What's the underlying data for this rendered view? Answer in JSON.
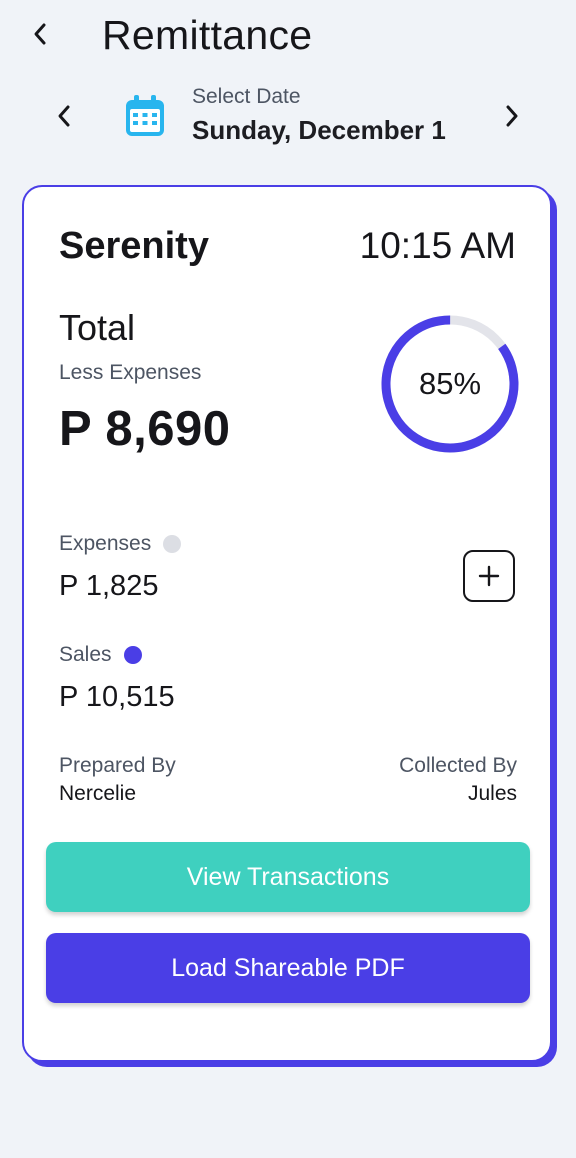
{
  "header": {
    "title": "Remittance",
    "back_icon": "chevron-left-icon"
  },
  "date_selector": {
    "caption": "Select Date",
    "value": "Sunday, December 1",
    "icon": "calendar-icon",
    "icon_color": "#28b5ee"
  },
  "card": {
    "unit_name": "Serenity",
    "time": "10:15 AM",
    "total_label": "Total",
    "total_sublabel": "Less Expenses",
    "total_value": "P 8,690",
    "progress": {
      "percent": 85,
      "label": "85%",
      "fill_color": "#4a3ee6",
      "track_color": "#e3e4ea"
    },
    "expenses": {
      "label": "Expenses",
      "value": "P 1,825",
      "dot_color": "#dcdee4"
    },
    "sales": {
      "label": "Sales",
      "value": "P 10,515",
      "dot_color": "#4a3ee6"
    },
    "add_icon": "plus-icon",
    "prepared_by": {
      "label": "Prepared By",
      "name": "Nercelie"
    },
    "collected_by": {
      "label": "Collected By",
      "name": "Jules"
    },
    "buttons": {
      "view_transactions": "View Transactions",
      "load_pdf": "Load Shareable PDF"
    }
  },
  "colors": {
    "accent": "#4a3ee6",
    "teal": "#3fd0bf",
    "background": "#f0f3f8"
  }
}
